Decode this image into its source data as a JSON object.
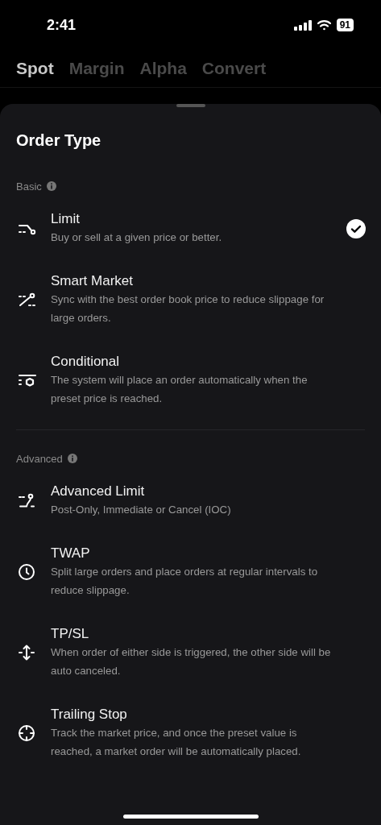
{
  "status_bar": {
    "time": "2:41",
    "battery": "91"
  },
  "tabs": [
    {
      "label": "Spot",
      "selected": true
    },
    {
      "label": "Margin",
      "selected": false
    },
    {
      "label": "Alpha",
      "selected": false
    },
    {
      "label": "Convert",
      "selected": false
    }
  ],
  "sheet": {
    "title": "Order Type",
    "groups": [
      {
        "label": "Basic",
        "items": [
          {
            "title": "Limit",
            "description": "Buy or sell at a given price or better.",
            "selected": true
          },
          {
            "title": "Smart Market",
            "description": "Sync with the best order book price to reduce slippage for large orders.",
            "selected": false
          },
          {
            "title": "Conditional",
            "description": "The system will place an order automatically when the preset price is reached.",
            "selected": false
          }
        ]
      },
      {
        "label": "Advanced",
        "items": [
          {
            "title": "Advanced Limit",
            "description": "Post-Only, Immediate or Cancel (IOC)",
            "selected": false
          },
          {
            "title": "TWAP",
            "description": "Split large orders and place orders at regular intervals to reduce slippage.",
            "selected": false
          },
          {
            "title": "TP/SL",
            "description": "When order of either side is triggered, the other side will be auto canceled.",
            "selected": false
          },
          {
            "title": "Trailing Stop",
            "description": "Track the market price, and once the preset value is reached, a market order will be automatically placed.",
            "selected": false
          }
        ]
      }
    ]
  }
}
